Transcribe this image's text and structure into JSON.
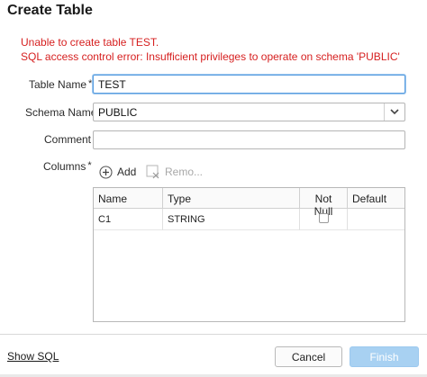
{
  "dialog": {
    "title": "Create Table",
    "error_line1": "Unable to create table TEST.",
    "error_line2": "SQL access control error: Insufficient privileges to operate on schema 'PUBLIC'",
    "error_color": "#d61f1f"
  },
  "form": {
    "table_name_label": "Table Name",
    "table_name_value": "TEST",
    "schema_name_label": "Schema Name",
    "schema_name_value": "PUBLIC",
    "comment_label": "Comment",
    "comment_value": "",
    "columns_label": "Columns",
    "required_mark": "*"
  },
  "columns_toolbar": {
    "add_label": "Add",
    "add_icon": "plus-circle-icon",
    "remove_label": "Remo...",
    "remove_icon": "remove-icon"
  },
  "columns_table": {
    "headers": [
      "Name",
      "Type",
      "Not Null",
      "Default"
    ],
    "rows": [
      {
        "name": "C1",
        "type": "STRING",
        "not_null": false,
        "default": ""
      }
    ]
  },
  "footer": {
    "show_sql_label": "Show SQL",
    "cancel_label": "Cancel",
    "finish_label": "Finish",
    "finish_color": "#a8d1f2"
  }
}
